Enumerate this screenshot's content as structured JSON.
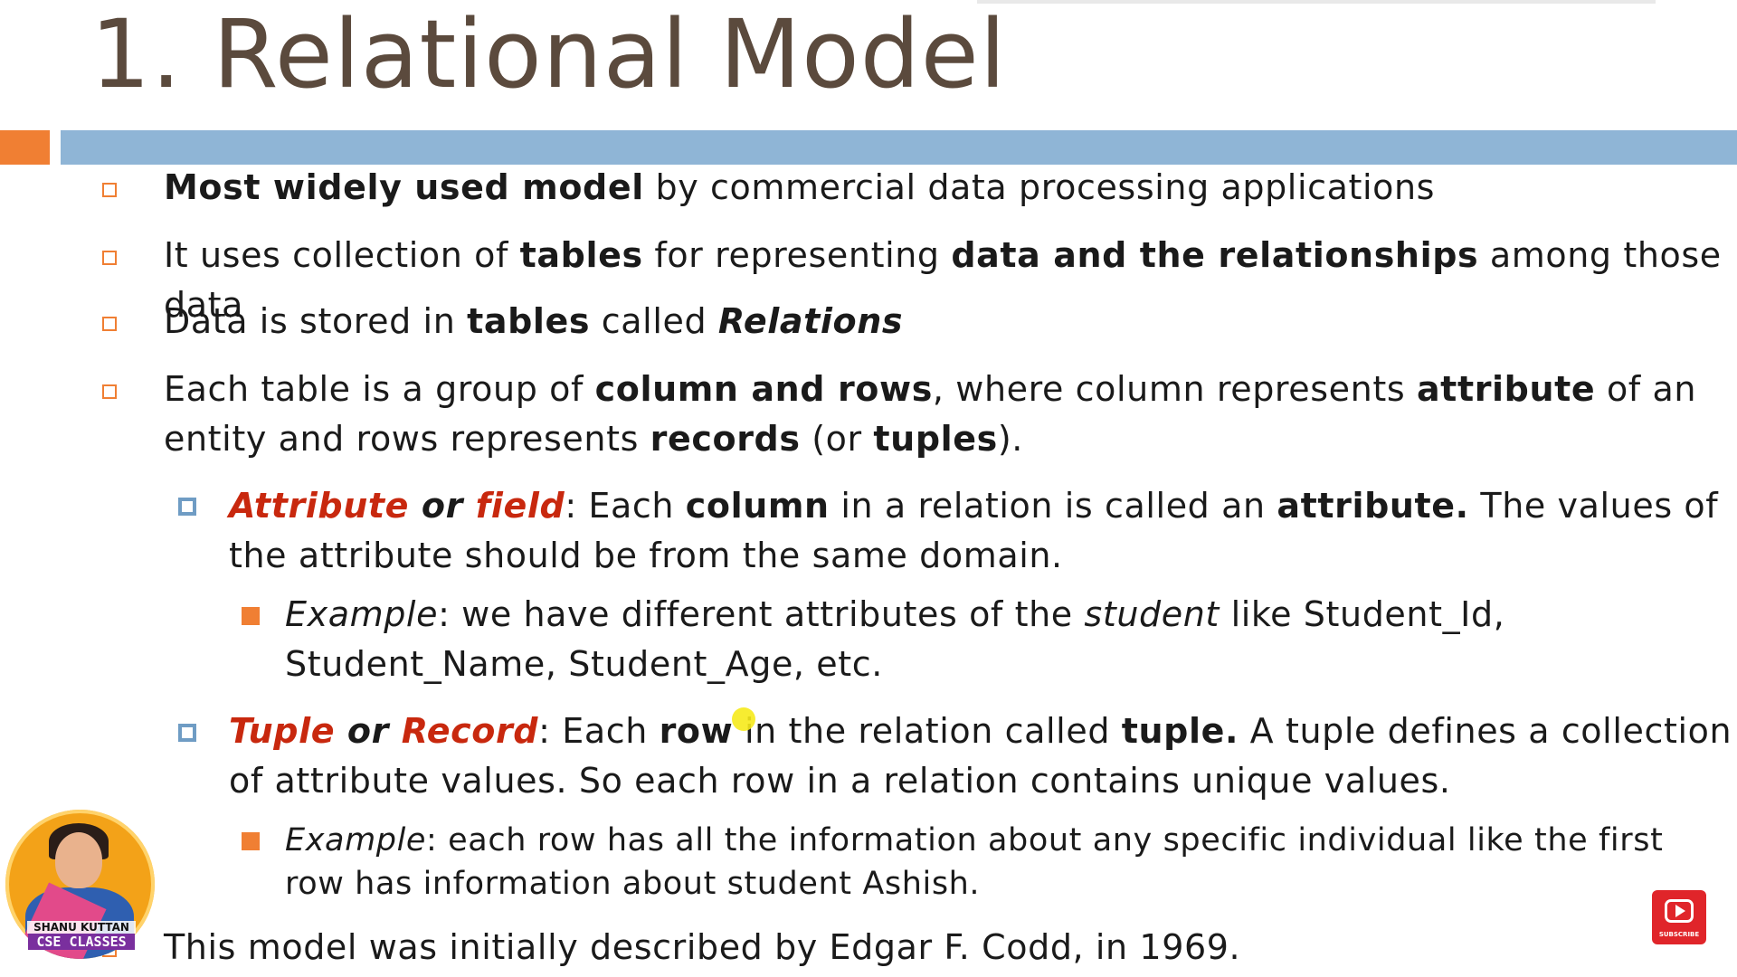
{
  "slide": {
    "title": "1. Relational Model",
    "colors": {
      "title": "#5b4a3d",
      "accent_orange": "#f07f33",
      "bar_blue": "#8fb5d6",
      "bullet_blue": "#6f9cc4",
      "highlight_red": "#c8280e"
    },
    "bullets": [
      {
        "b1_bold": "Most widely used model",
        "b1_rest": " by commercial data processing applications"
      },
      {
        "b2_pre": "It uses collection of ",
        "b2_bold1": "tables",
        "b2_mid": " for representing ",
        "b2_bold2": "data and the relationships",
        "b2_post": " among those data"
      },
      {
        "b3_pre": "Data is stored in ",
        "b3_bold": "tables",
        "b3_mid": " called ",
        "b3_boldital": "Relations"
      },
      {
        "b4_pre": "Each table is a group of ",
        "b4_bold1": "column and rows",
        "b4_mid1": ", where column represents ",
        "b4_bold2": "attribute",
        "b4_mid2": " of an entity and rows represents ",
        "b4_bold3": "records",
        "b4_mid3": " (or ",
        "b4_bold4": "tuples",
        "b4_post": ")."
      }
    ],
    "attribute": {
      "term1": "Attribute",
      "or": " or ",
      "term2": "field",
      "colon": ": Each ",
      "bold1": "column",
      "mid": " in a relation is called an ",
      "bold2": "attribute.",
      "post": " The values of the attribute should be from the same domain.",
      "example_label": "Example",
      "example_mid": ": we have different attributes of the ",
      "example_ital": "student",
      "example_post": " like Student_Id, Student_Name, Student_Age, etc."
    },
    "tuple": {
      "term1": "Tuple",
      "or": " or ",
      "term2": "Record",
      "colon": ": Each ",
      "bold1": "row",
      "mid": " in the relation called ",
      "bold2": "tuple.",
      "post": " A tuple defines a collection of attribute values. So each row in a relation contains unique values.",
      "example_label": "Example",
      "example_text": ": each row has all the information about any specific individual like the first row has information about student Ashish."
    },
    "final_bullet": "This model was initially described by Edgar F. Codd, in 1969."
  },
  "overlay": {
    "avatar_name": "SHANU KUTTAN",
    "avatar_badge": "CSE CLASSES",
    "subscribe_label": "SUBSCRIBE"
  }
}
